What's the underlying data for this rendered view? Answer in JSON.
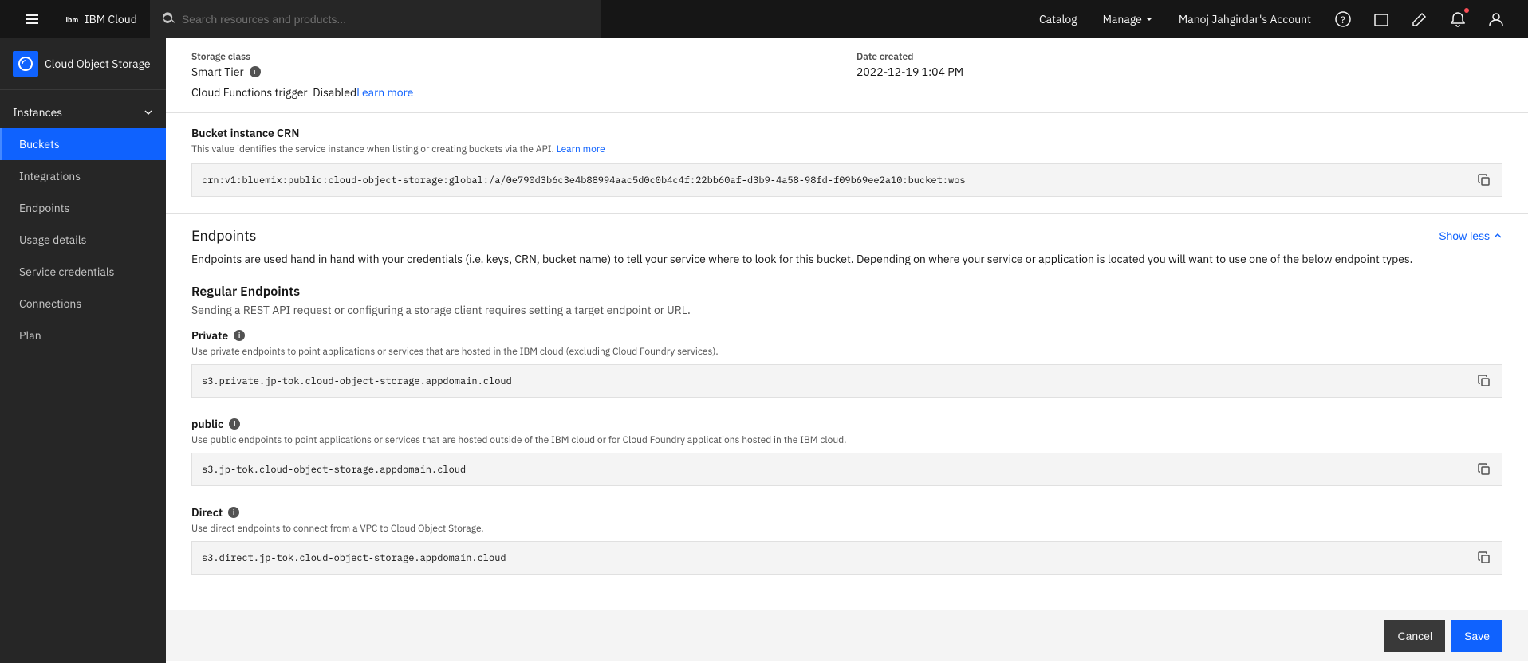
{
  "topnav": {
    "brand": "IBM Cloud",
    "search_placeholder": "Search resources and products...",
    "nav_links": [
      {
        "label": "Catalog"
      },
      {
        "label": "Manage",
        "has_chevron": true
      },
      {
        "label": "Manoj Jahgirdar's Account"
      }
    ],
    "icons": [
      "help",
      "calendar",
      "edit",
      "bell",
      "user"
    ]
  },
  "sidebar": {
    "brand_label": "Cloud Object Storage",
    "section_label": "Instances",
    "nav_items": [
      {
        "label": "Buckets",
        "active": true
      },
      {
        "label": "Integrations",
        "active": false
      },
      {
        "label": "Endpoints",
        "active": false
      },
      {
        "label": "Usage details",
        "active": false
      },
      {
        "label": "Service credentials",
        "active": false
      },
      {
        "label": "Connections",
        "active": false
      },
      {
        "label": "Plan",
        "active": false
      }
    ]
  },
  "storage_class": {
    "label": "Storage class",
    "value": "Smart Tier",
    "info_icon": "i",
    "cf_trigger_label": "Cloud Functions trigger",
    "cf_trigger_value": "Disabled",
    "cf_learn_more": "Learn more"
  },
  "date_created": {
    "label": "Date created",
    "value": "2022-12-19 1:04 PM"
  },
  "bucket_crn": {
    "title": "Bucket instance CRN",
    "description": "This value identifies the service instance when listing or creating buckets via the API.",
    "learn_more": "Learn more",
    "crn_value": "crn:v1:bluemix:public:cloud-object-storage:global:/a/0e790d3b6c3e4b88994aac5d0c0b4c4f:22bb60af-d3b9-4a58-98fd-f09b69ee2a10:bucket:wos",
    "copy_icon": "copy"
  },
  "endpoints": {
    "section_title": "Endpoints",
    "show_less_label": "Show less",
    "description": "Endpoints are used hand in hand with your credentials (i.e. keys, CRN, bucket name) to tell your service where to look for this bucket. Depending on where your service or application is located you will want to use one of the below endpoint types.",
    "regular_title": "Regular Endpoints",
    "regular_desc": "Sending a REST API request or configuring a storage client requires setting a target endpoint or URL.",
    "private_title": "Private",
    "private_info": "i",
    "private_desc": "Use private endpoints to point applications or services that are hosted in the IBM cloud (excluding Cloud Foundry services).",
    "private_value": "s3.private.jp-tok.cloud-object-storage.appdomain.cloud",
    "public_title": "public",
    "public_info": "i",
    "public_desc": "Use public endpoints to point applications or services that are hosted outside of the IBM cloud or for Cloud Foundry applications hosted in the IBM cloud.",
    "public_value": "s3.jp-tok.cloud-object-storage.appdomain.cloud",
    "direct_title": "Direct",
    "direct_info": "i",
    "direct_desc": "Use direct endpoints to connect from a VPC to Cloud Object Storage.",
    "direct_value": "s3.direct.jp-tok.cloud-object-storage.appdomain.cloud"
  },
  "bottom_bar": {
    "save_label": "Save",
    "cancel_label": "Cancel"
  }
}
